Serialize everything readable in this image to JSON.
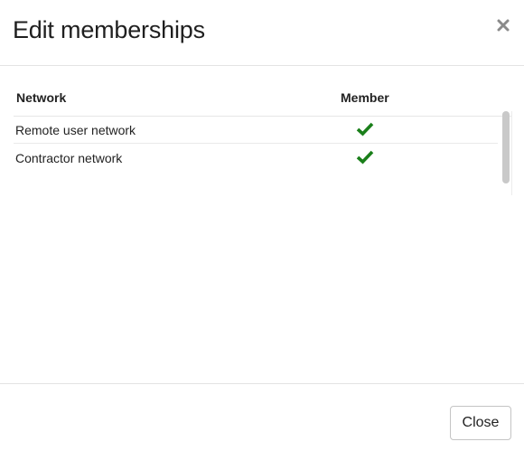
{
  "dialog": {
    "title": "Edit memberships",
    "close_icon": "close-icon"
  },
  "table": {
    "columns": [
      "Network",
      "Member"
    ],
    "rows": [
      {
        "network": "Remote user network",
        "member": true
      },
      {
        "network": "Contractor network",
        "member": true
      }
    ],
    "check_icon": "checkmark-icon",
    "check_color": "#1a7f1a"
  },
  "footer": {
    "close_label": "Close"
  }
}
